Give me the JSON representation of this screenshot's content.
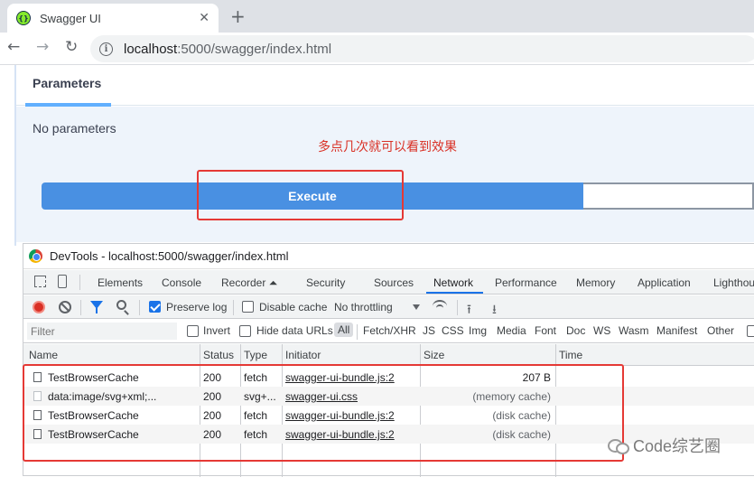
{
  "browser": {
    "tab_title": "Swagger UI",
    "tab_close": "✕",
    "new_tab": "+",
    "url_host": "localhost",
    "url_rest": ":5000/swagger/index.html"
  },
  "swagger": {
    "parameters_title": "Parameters",
    "no_parameters": "No parameters",
    "annotation": "多点几次就可以看到效果",
    "execute_label": "Execute"
  },
  "devtools": {
    "title": "DevTools - localhost:5000/swagger/index.html",
    "tabs": [
      "Elements",
      "Console",
      "Recorder ⏶",
      "Security",
      "Sources",
      "Network",
      "Performance",
      "Memory",
      "Application",
      "Lighthou"
    ],
    "active_tab": "Network",
    "controls": {
      "preserve_log": "Preserve log",
      "preserve_log_checked": true,
      "disable_cache": "Disable cache",
      "disable_cache_checked": false,
      "throttling": "No throttling"
    },
    "filter": {
      "placeholder": "Filter",
      "invert": "Invert",
      "hide_data_urls": "Hide data URLs",
      "types": [
        "All",
        "Fetch/XHR",
        "JS",
        "CSS",
        "Img",
        "Media",
        "Font",
        "Doc",
        "WS",
        "Wasm",
        "Manifest",
        "Other"
      ],
      "active_type": "All"
    },
    "columns": [
      "Name",
      "Status",
      "Type",
      "Initiator",
      "Size",
      "Time"
    ],
    "rows": [
      {
        "name": "TestBrowserCache",
        "status": "200",
        "type": "fetch",
        "initiator": "swagger-ui-bundle.js:2",
        "size": "207 B",
        "time": ""
      },
      {
        "name": "data:image/svg+xml;...",
        "status": "200",
        "type": "svg+...",
        "initiator": "swagger-ui.css",
        "size": "(memory cache)",
        "time": ""
      },
      {
        "name": "TestBrowserCache",
        "status": "200",
        "type": "fetch",
        "initiator": "swagger-ui-bundle.js:2",
        "size": "(disk cache)",
        "time": ""
      },
      {
        "name": "TestBrowserCache",
        "status": "200",
        "type": "fetch",
        "initiator": "swagger-ui-bundle.js:2",
        "size": "(disk cache)",
        "time": ""
      }
    ]
  },
  "watermark": "Code综艺圈",
  "colors": {
    "execute_blue": "#4990e2",
    "annotation_red": "#d93025",
    "highlight_box": "#e53935",
    "devtools_accent": "#1a73e8"
  }
}
